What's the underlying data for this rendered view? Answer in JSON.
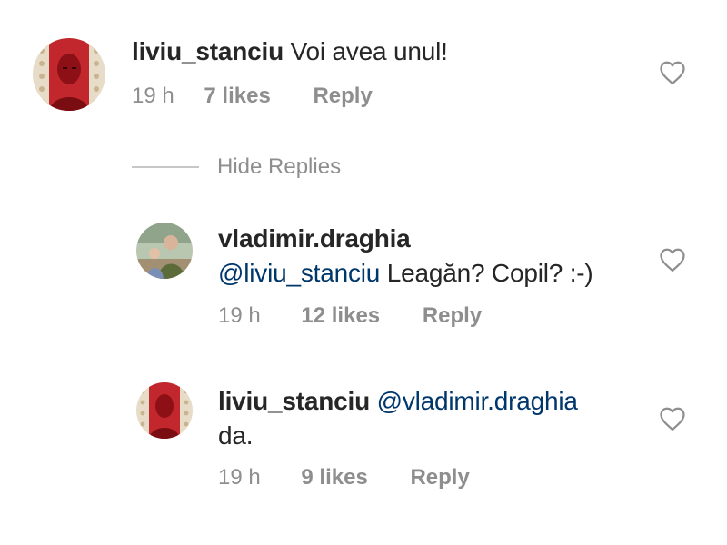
{
  "comments": [
    {
      "username": "liviu_stanciu",
      "text": "Voi avea unul!",
      "time": "19 h",
      "likes": "7 likes",
      "reply": "Reply",
      "avatar": "avatar-red-portrait"
    }
  ],
  "hide_replies": "Hide Replies",
  "replies": [
    {
      "username": "vladimir.draghia",
      "mention": "@liviu_stanciu",
      "text": "Leagăn? Copil? :-)",
      "time": "19 h",
      "likes": "12 likes",
      "reply": "Reply",
      "avatar": "avatar-man-with-child"
    },
    {
      "username": "liviu_stanciu",
      "mention": "@vladimir.draghia",
      "text": "da.",
      "time": "19 h",
      "likes": "9 likes",
      "reply": "Reply",
      "avatar": "avatar-red-portrait"
    }
  ],
  "icons": {
    "like": "heart-outline-icon"
  },
  "colors": {
    "text": "#262626",
    "meta": "#8e8e8e",
    "mention": "#00376b",
    "avatar_red": "#c1272d"
  }
}
